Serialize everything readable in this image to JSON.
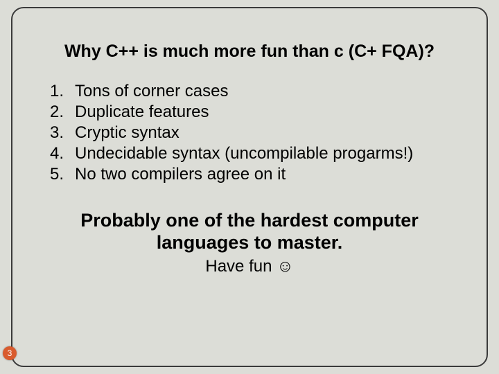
{
  "slide": {
    "title": "Why C++ is much more fun than c (C+ FQA)?",
    "items": [
      {
        "num": "1.",
        "text": "Tons of corner cases"
      },
      {
        "num": "2.",
        "text": "Duplicate features"
      },
      {
        "num": "3.",
        "text": "Cryptic syntax"
      },
      {
        "num": "4.",
        "text": "Undecidable syntax (uncompilable progarms!)"
      },
      {
        "num": "5.",
        "text": "No two compilers agree on it"
      }
    ],
    "subtitle": "Probably one of the hardest computer languages to master.",
    "closing": "Have fun ☺",
    "page_number": "3"
  }
}
